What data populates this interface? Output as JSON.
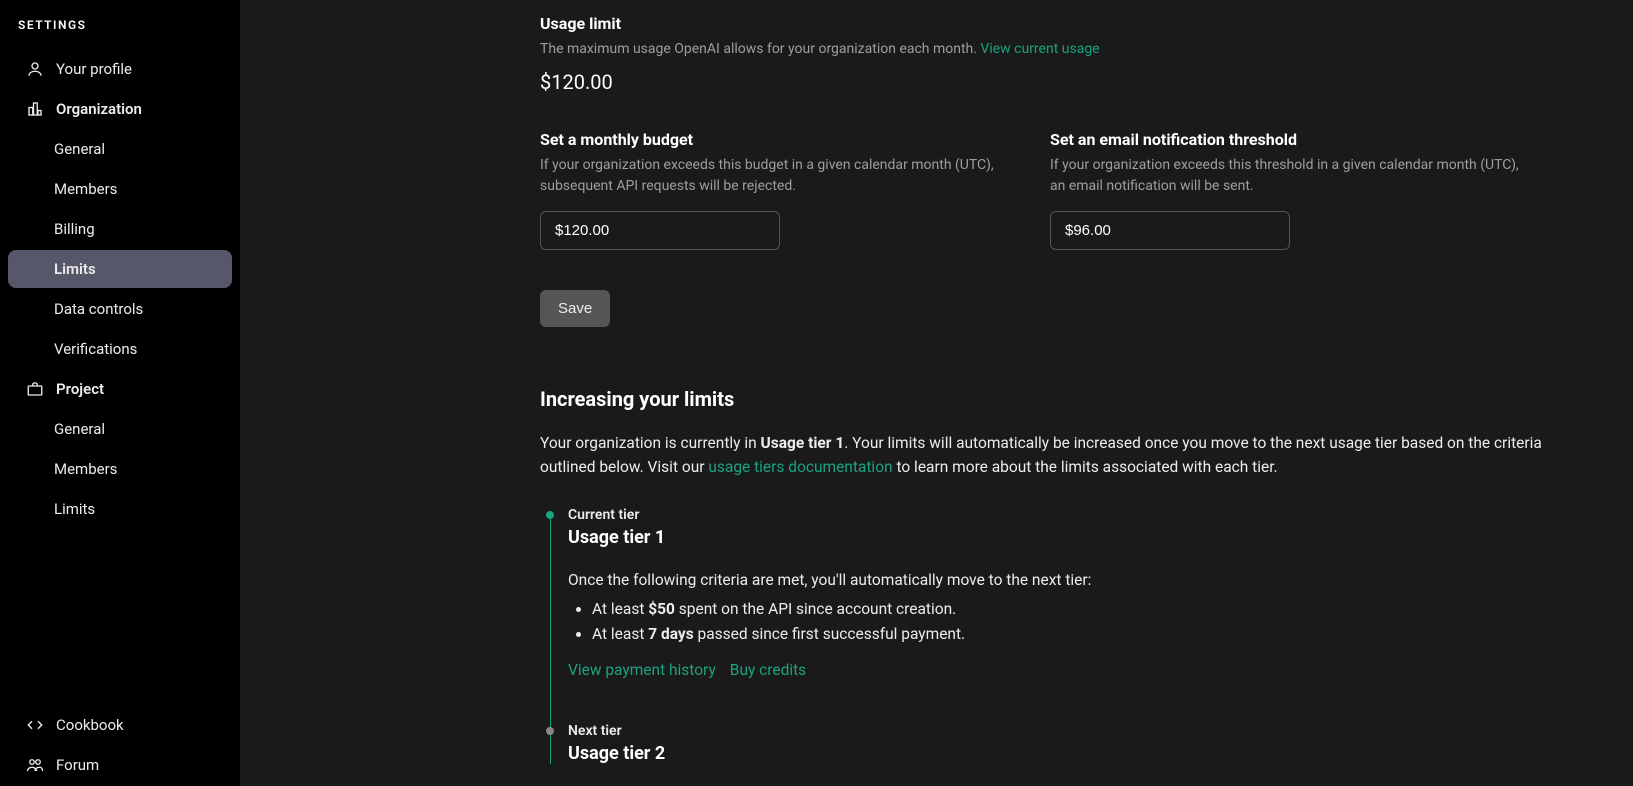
{
  "sidebar": {
    "header": "SETTINGS",
    "profile": "Your profile",
    "organization": {
      "label": "Organization",
      "items": [
        "General",
        "Members",
        "Billing",
        "Limits",
        "Data controls",
        "Verifications"
      ],
      "active_index": 3
    },
    "project": {
      "label": "Project",
      "items": [
        "General",
        "Members",
        "Limits"
      ]
    },
    "bottom": [
      "Cookbook",
      "Forum"
    ]
  },
  "usage_limit": {
    "title": "Usage limit",
    "desc": "The maximum usage OpenAI allows for your organization each month. ",
    "link_text": "View current usage",
    "value": "$120.00"
  },
  "budget": {
    "title": "Set a monthly budget",
    "desc": "If your organization exceeds this budget in a given calendar month (UTC), subsequent API requests will be rejected.",
    "value": "$120.00"
  },
  "threshold": {
    "title": "Set an email notification threshold",
    "desc": "If your organization exceeds this threshold in a given calendar month (UTC), an email notification will be sent.",
    "value": "$96.00"
  },
  "save_label": "Save",
  "increasing": {
    "heading": "Increasing your limits",
    "para_pre": "Your organization is currently in ",
    "tier_bold": "Usage tier 1",
    "para_mid": ". Your limits will automatically be increased once you move to the next usage tier based on the criteria outlined below. Visit our ",
    "doc_link": "usage tiers documentation",
    "para_post": " to learn more about the limits associated with each tier."
  },
  "tier_current": {
    "label": "Current tier",
    "name": "Usage tier 1",
    "intro": "Once the following criteria are met, you'll automatically move to the next tier:",
    "c1_pre": "At least ",
    "c1_bold": "$50",
    "c1_post": " spent on the API since account creation.",
    "c2_pre": "At least ",
    "c2_bold": "7 days",
    "c2_post": " passed since first successful payment.",
    "link1": "View payment history",
    "link2": "Buy credits"
  },
  "tier_next": {
    "label": "Next tier",
    "name": "Usage tier 2"
  }
}
